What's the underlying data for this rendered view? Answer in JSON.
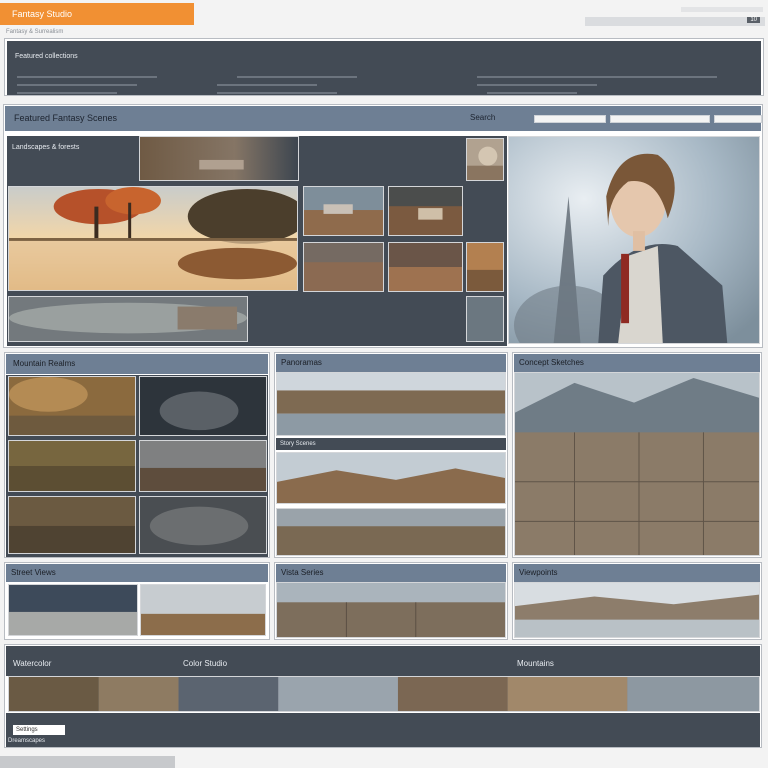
{
  "app": {
    "title": "Fantasy Studio",
    "subtitle": "Fantasy & Surrealism",
    "top_right": "10"
  },
  "sections": {
    "top_banner": "Featured collections",
    "main_header": "Featured Fantasy Scenes",
    "main_search": "Search",
    "left_header": "Landscapes & forests",
    "gallery_headers": [
      "Mountain Realms",
      "Panoramas",
      "Story Scenes",
      "Concept Sketches",
      "Street Views",
      "Vista Series",
      "Viewpoints",
      "Dreamscapes"
    ],
    "bottom_bar_labels": [
      "Watercolor",
      "Color Studio",
      "Mountains"
    ],
    "bottom_caption": "Settings"
  },
  "colors": {
    "accent": "#f19033",
    "panel_dark": "#434b55",
    "panel_slate": "#6e7f94",
    "panel_mid": "#59626d"
  },
  "icons": {
    "orange_tab": "tag-icon",
    "top_right_button": "menu-icon"
  }
}
